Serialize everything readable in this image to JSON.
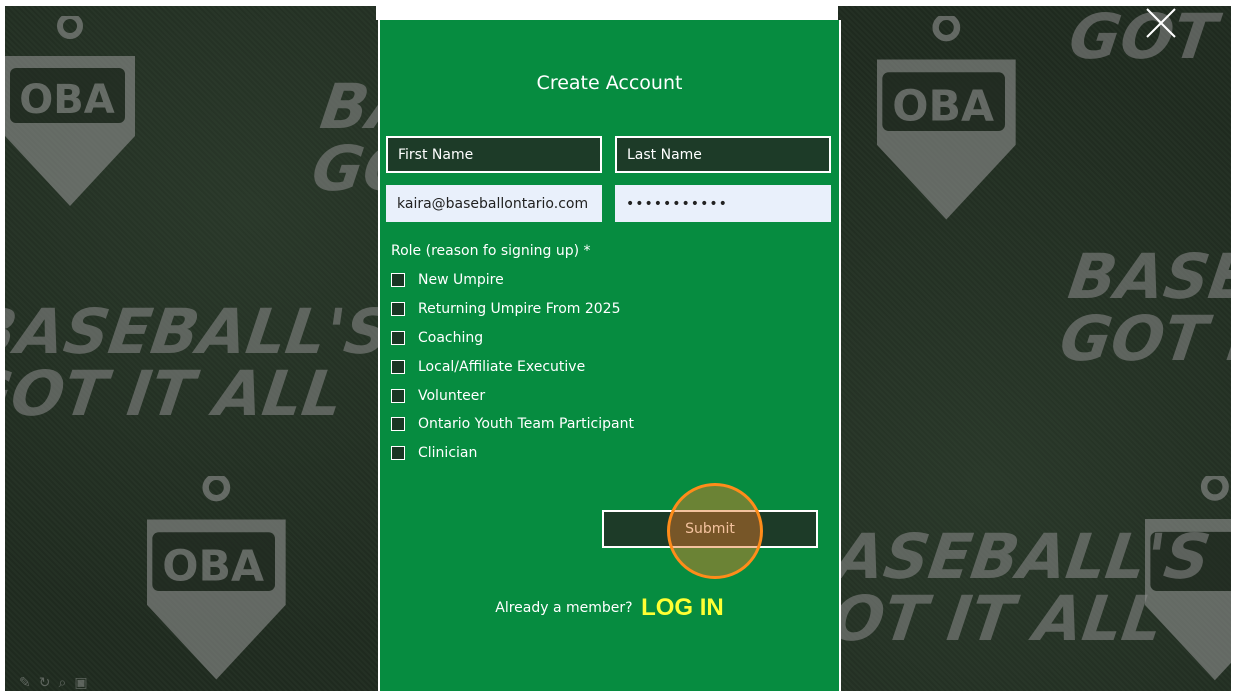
{
  "background": {
    "logo_text": "OBA",
    "slogan_line1": "BASEBALL'S",
    "slogan_line2": "GOT IT ALL"
  },
  "form": {
    "title": "Create Account",
    "first_name": {
      "value": "",
      "placeholder": "First Name"
    },
    "last_name": {
      "value": "",
      "placeholder": "Last Name"
    },
    "email": {
      "value": "kaira@baseballontario.com",
      "placeholder": ""
    },
    "password": {
      "value": "***********",
      "placeholder": ""
    },
    "role_label": "Role (reason fo signing up) *",
    "roles": [
      {
        "label": "New Umpire",
        "checked": false
      },
      {
        "label": "Returning Umpire From 2025",
        "checked": false
      },
      {
        "label": "Coaching",
        "checked": false
      },
      {
        "label": "Local/Affiliate Executive",
        "checked": false
      },
      {
        "label": "Volunteer",
        "checked": false
      },
      {
        "label": "Ontario Youth Team Participant",
        "checked": false
      },
      {
        "label": "Clinician",
        "checked": false
      }
    ],
    "submit_label": "Submit",
    "already_member_text": "Already a member?",
    "login_label": "LOG IN"
  },
  "colors": {
    "modal_bg": "#068c40",
    "field_dark": "#1d3b28",
    "field_light": "#e9f0fb",
    "login_accent": "#ffff33",
    "click_indicator": "#ff8c1a"
  },
  "icons": {
    "close": "close-icon",
    "checkbox": "checkbox-icon"
  }
}
